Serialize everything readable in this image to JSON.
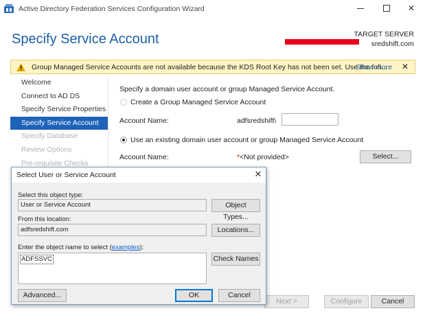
{
  "window": {
    "title": "Active Directory Federation Services Configuration Wizard",
    "controls": {
      "minimize": "—",
      "maximize": "☐",
      "close": "✕"
    }
  },
  "header": {
    "page_title": "Specify Service Account",
    "target_label": "TARGET SERVER",
    "target_name": "sredshift.com"
  },
  "warning": {
    "text": "Group Managed Service Accounts are not available because the KDS Root Key has not been set. Use the foll...",
    "link": "Show more",
    "close": "✕"
  },
  "nav": {
    "items": [
      {
        "label": "Welcome",
        "state": "normal"
      },
      {
        "label": "Connect to AD DS",
        "state": "normal"
      },
      {
        "label": "Specify Service Properties",
        "state": "normal"
      },
      {
        "label": "Specify Service Account",
        "state": "active"
      },
      {
        "label": "Specify Database",
        "state": "disabled"
      },
      {
        "label": "Review Options",
        "state": "disabled"
      },
      {
        "label": "Pre-requisite Checks",
        "state": "disabled"
      }
    ]
  },
  "content": {
    "intro": "Specify a domain user account or group Managed Service Account.",
    "option_gmsa": {
      "label": "Create a Group Managed Service Account",
      "checked": false
    },
    "gmsa_account_label": "Account Name:",
    "gmsa_domain_prefix": "adfsredshift\\",
    "gmsa_account_value": "",
    "option_existing": {
      "label": "Use an existing domain user account or group Managed Service Account",
      "checked": true
    },
    "existing_account_label": "Account Name:",
    "existing_required_mark": "*",
    "existing_account_value": "<Not provided>",
    "select_button": "Select..."
  },
  "footer": {
    "next": "Next >",
    "configure": "Configure",
    "cancel": "Cancel"
  },
  "dialog": {
    "title": "Select User or Service Account",
    "close": "✕",
    "object_type_label": "Select this object type:",
    "object_type_value": "User or Service Account",
    "object_types_button": "Object Types...",
    "location_label": "From this location:",
    "location_value": "adfsredshift.com",
    "locations_button": "Locations...",
    "name_label_prefix": "Enter the object name to select (",
    "name_label_link": "examples",
    "name_label_suffix": "):",
    "name_value": "ADFSSVC",
    "check_names_button": "Check Names",
    "advanced_button": "Advanced...",
    "ok_button": "OK",
    "cancel_button": "Cancel"
  },
  "colors": {
    "title_blue": "#1c5fa8",
    "nav_active": "#1d63b8",
    "warning_bg": "#fff5c6",
    "redaction": "#e8001c"
  }
}
